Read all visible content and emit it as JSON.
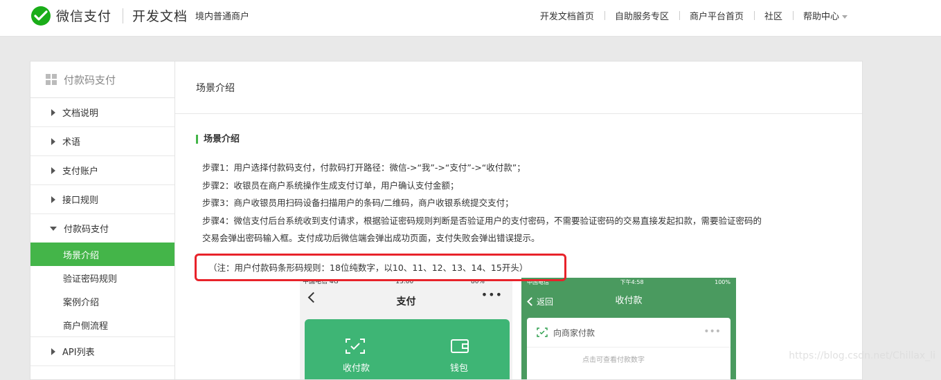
{
  "header": {
    "brand": "微信支付",
    "brand2": "开发文档",
    "brand_sub": "境内普通商户",
    "nav": [
      "开发文档首页",
      "自助服务专区",
      "商户平台首页",
      "社区",
      "帮助中心"
    ]
  },
  "sidebar": {
    "title": "付款码支付",
    "items": [
      "文档说明",
      "术语",
      "支付账户",
      "接口规则",
      "付款码支付"
    ],
    "sub_items": [
      "场景介绍",
      "验证密码规则",
      "案例介绍",
      "商户侧流程"
    ],
    "active_sub": "场景介绍",
    "after": "API列表"
  },
  "main": {
    "header": "场景介绍",
    "section_title": "场景介绍",
    "steps": [
      "步骤1：用户选择付款码支付，付款码打开路径：微信->“我”->“支付”->“收付款”；",
      "步骤2：收银员在商户系统操作生成支付订单，用户确认支付金额；",
      "步骤3：商户收银员用扫码设备扫描用户的条码/二维码，商户收银系统提交支付；",
      "步骤4：微信支付后台系统收到支付请求，根据验证密码规则判断是否验证用户的支付密码，不需要验证密码的交易直接发起扣款，需要验证密码的",
      "交易会弹出密码输入框。支付成功后微信端会弹出成功页面，支付失败会弹出错误提示。"
    ],
    "note": "（注：用户付款码条形码规则：18位纯数字，以10、11、12、13、14、15开头）"
  },
  "phone1": {
    "status_left": "中国电信 4G",
    "status_mid": "13:00",
    "status_right": "80%",
    "title": "支付",
    "more": "•••",
    "tile1": "收付款",
    "tile2": "钱包"
  },
  "phone2": {
    "status_left": "中国电信",
    "status_mid": "下午4:58",
    "status_right": "100%",
    "back": "返回",
    "title": "收付款",
    "card_title": "向商家付款",
    "card_more": "•••",
    "card_text": "点击可查看付款数字"
  },
  "watermark": "https://blog.csdn.net/Chillax_li",
  "colors": {
    "accent": "#44b549",
    "highlight": "#e8222a"
  }
}
